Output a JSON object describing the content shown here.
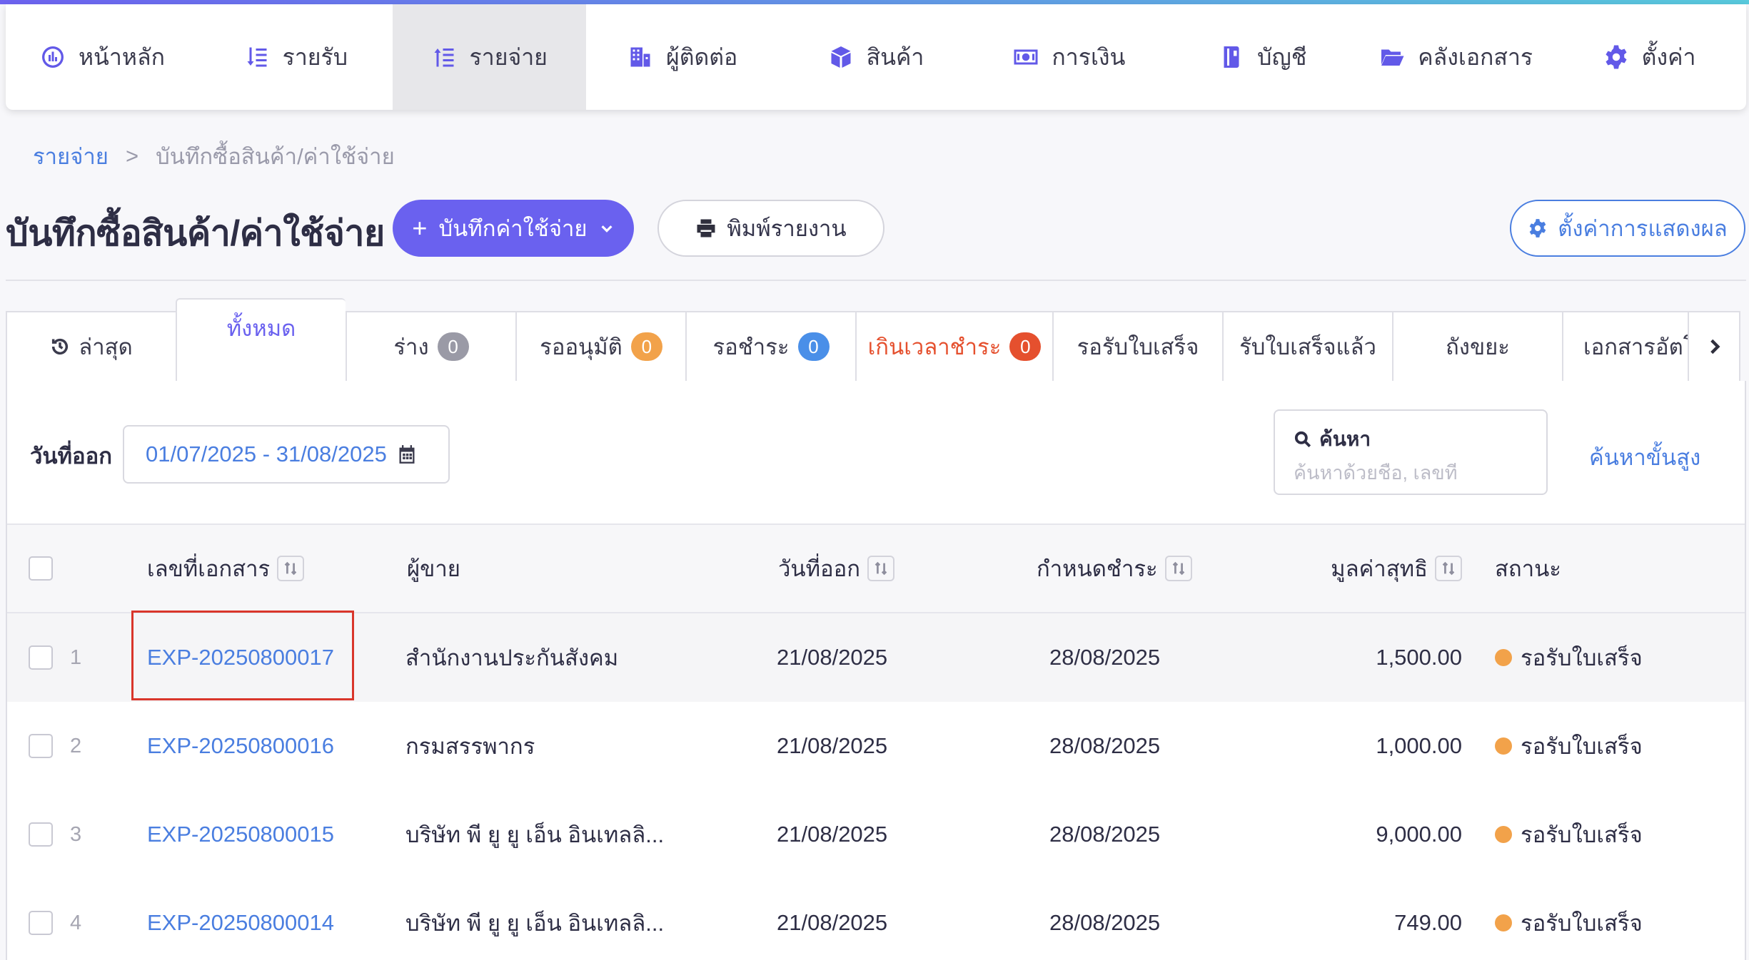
{
  "nav": {
    "items": [
      {
        "label": "หน้าหลัก",
        "icon": "dashboard-icon"
      },
      {
        "label": "รายรับ",
        "icon": "income-icon"
      },
      {
        "label": "รายจ่าย",
        "icon": "expense-icon",
        "active": true
      },
      {
        "label": "ผู้ติดต่อ",
        "icon": "contacts-icon"
      },
      {
        "label": "สินค้า",
        "icon": "product-box-icon"
      },
      {
        "label": "การเงิน",
        "icon": "money-icon"
      },
      {
        "label": "บัญชี",
        "icon": "account-book-icon"
      },
      {
        "label": "คลังเอกสาร",
        "icon": "folder-icon"
      },
      {
        "label": "ตั้งค่า",
        "icon": "gear-icon"
      }
    ],
    "accent_color": "#6259e8"
  },
  "breadcrumb": {
    "parent": "รายจ่าย",
    "separator": ">",
    "current": "บันทึกซื้อสินค้า/ค่าใช้จ่าย"
  },
  "header": {
    "title": "บันทึกซื้อสินค้า/ค่าใช้จ่าย",
    "primary_button": "บันทึกค่าใช้จ่าย",
    "print_button": "พิมพ์รายงาน",
    "settings_button": "ตั้งค่าการแสดงผล"
  },
  "tabs": [
    {
      "label": "ล่าสุด",
      "icon": "history-icon"
    },
    {
      "label": "ทั้งหมด",
      "active": true
    },
    {
      "label": "ร่าง",
      "badge": "0",
      "badge_color": "#9a9aa6"
    },
    {
      "label": "รออนุมัติ",
      "badge": "0",
      "badge_color": "#f2a24a"
    },
    {
      "label": "รอชำระ",
      "badge": "0",
      "badge_color": "#4a8fe8"
    },
    {
      "label": "เกินเวลาชำระ",
      "badge": "0",
      "badge_color": "#e5502e",
      "danger": true
    },
    {
      "label": "รอรับใบเสร็จ"
    },
    {
      "label": "รับใบเสร็จแล้ว"
    },
    {
      "label": "ถังขยะ"
    },
    {
      "label": "เอกสารอัตโ"
    }
  ],
  "filters": {
    "date_label": "วันที่ออก",
    "date_range": "01/07/2025 - 31/08/2025",
    "search_label": "ค้นหา",
    "search_placeholder": "ค้นหาด้วยชื่อ, เลขที่",
    "advanced_search": "ค้นหาขั้นสูง"
  },
  "table": {
    "columns": {
      "doc_no": "เลขที่เอกสาร",
      "vendor": "ผู้ขาย",
      "issue_date": "วันที่ออก",
      "due_date": "กำหนดชำระ",
      "net_amount": "มูลค่าสุทธิ",
      "status": "สถานะ"
    },
    "rows": [
      {
        "num": "1",
        "doc_no": "EXP-20250800017",
        "vendor": "สำนักงานประกันสังคม",
        "issue_date": "21/08/2025",
        "due_date": "28/08/2025",
        "amount": "1,500.00",
        "status": "รอรับใบเสร็จ"
      },
      {
        "num": "2",
        "doc_no": "EXP-20250800016",
        "vendor": "กรมสรรพากร",
        "issue_date": "21/08/2025",
        "due_date": "28/08/2025",
        "amount": "1,000.00",
        "status": "รอรับใบเสร็จ"
      },
      {
        "num": "3",
        "doc_no": "EXP-20250800015",
        "vendor": "บริษัท พี ยู ยู เอ็น อินเทลลิ...",
        "issue_date": "21/08/2025",
        "due_date": "28/08/2025",
        "amount": "9,000.00",
        "status": "รอรับใบเสร็จ"
      },
      {
        "num": "4",
        "doc_no": "EXP-20250800014",
        "vendor": "บริษัท พี ยู ยู เอ็น อินเทลลิ...",
        "issue_date": "21/08/2025",
        "due_date": "28/08/2025",
        "amount": "749.00",
        "status": "รอรับใบเสร็จ"
      }
    ],
    "status_color": "#f2a24a",
    "link_color": "#4a7ee0"
  }
}
